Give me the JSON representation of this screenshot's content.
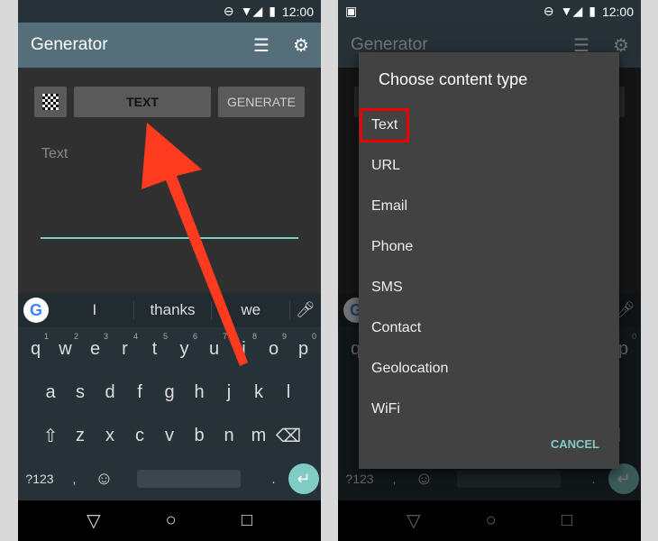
{
  "status": {
    "time": "12:00"
  },
  "app": {
    "title": "Generator",
    "list_icon": "list-icon",
    "settings_icon": "gear-icon"
  },
  "generator": {
    "type_button": "TEXT",
    "generate_button": "GENERATE",
    "input_placeholder": "Text"
  },
  "keyboard": {
    "suggestions": [
      "I",
      "thanks",
      "we"
    ],
    "row1": [
      "q",
      "w",
      "e",
      "r",
      "t",
      "y",
      "u",
      "i",
      "o",
      "p"
    ],
    "row1_nums": [
      "1",
      "2",
      "3",
      "4",
      "5",
      "6",
      "7",
      "8",
      "9",
      "0"
    ],
    "row2": [
      "a",
      "s",
      "d",
      "f",
      "g",
      "h",
      "j",
      "k",
      "l"
    ],
    "row3": [
      "z",
      "x",
      "c",
      "v",
      "b",
      "n",
      "m"
    ],
    "symbols": "?123",
    "comma": ",",
    "period": "."
  },
  "dialog": {
    "title": "Choose content type",
    "options": [
      "Text",
      "URL",
      "Email",
      "Phone",
      "SMS",
      "Contact",
      "Geolocation",
      "WiFi"
    ],
    "selected": "Text",
    "cancel": "CANCEL"
  },
  "colors": {
    "appbar": "#546e7a",
    "accent": "#80cbc4",
    "annotation": "#ff3b1f",
    "highlight": "#ee0000"
  }
}
